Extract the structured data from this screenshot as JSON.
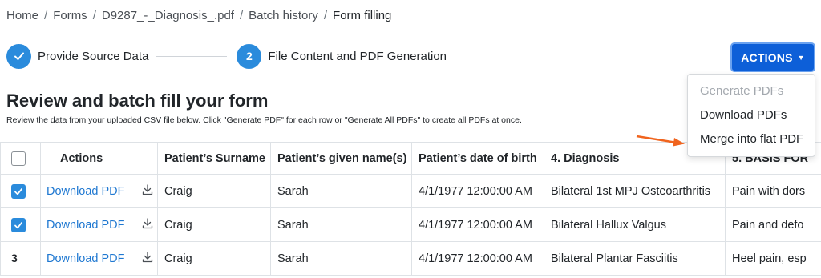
{
  "breadcrumb": {
    "items": [
      "Home",
      "Forms",
      "D9287_-_Diagnosis_.pdf",
      "Batch history",
      "Form filling"
    ],
    "separator": "/"
  },
  "stepper": {
    "step1": {
      "label": "Provide Source Data",
      "state": "completed"
    },
    "step2": {
      "number": "2",
      "label": "File Content and PDF Generation",
      "state": "active"
    }
  },
  "actions_button": {
    "label": "ACTIONS"
  },
  "dropdown": {
    "items": [
      {
        "label": "Generate PDFs",
        "disabled": true
      },
      {
        "label": "Download PDFs",
        "disabled": false
      },
      {
        "label": "Merge into flat PDF",
        "disabled": false
      }
    ]
  },
  "page": {
    "title": "Review and batch fill your form",
    "subtitle": "Review the data from your uploaded CSV file below. Click \"Generate PDF\" for each row or \"Generate All PDFs\" to create all PDFs at once."
  },
  "table": {
    "headers": [
      "Actions",
      "Patient’s Surname",
      "Patient’s given name(s)",
      "Patient’s date of birth",
      "4. Diagnosis",
      "5. BASIS FOR"
    ],
    "rows": [
      {
        "selector": "checked",
        "action": "Download PDF",
        "surname": "Craig",
        "given": "Sarah",
        "dob": "4/1/1977 12:00:00 AM",
        "diagnosis": "Bilateral 1st MPJ Osteoarthritis",
        "basis": "Pain with dors"
      },
      {
        "selector": "checked",
        "action": "Download PDF",
        "surname": "Craig",
        "given": "Sarah",
        "dob": "4/1/1977 12:00:00 AM",
        "diagnosis": "Bilateral Hallux Valgus",
        "basis": "Pain and defo"
      },
      {
        "selector": "3",
        "action": "Download PDF",
        "surname": "Craig",
        "given": "Sarah",
        "dob": "4/1/1977 12:00:00 AM",
        "diagnosis": "Bilateral Plantar Fasciitis",
        "basis": "Heel pain, esp"
      }
    ]
  },
  "colors": {
    "primary": "#0d5fd8",
    "step": "#2a8bdc",
    "link": "#1f78d1",
    "annotation_arrow": "#f0641e"
  }
}
